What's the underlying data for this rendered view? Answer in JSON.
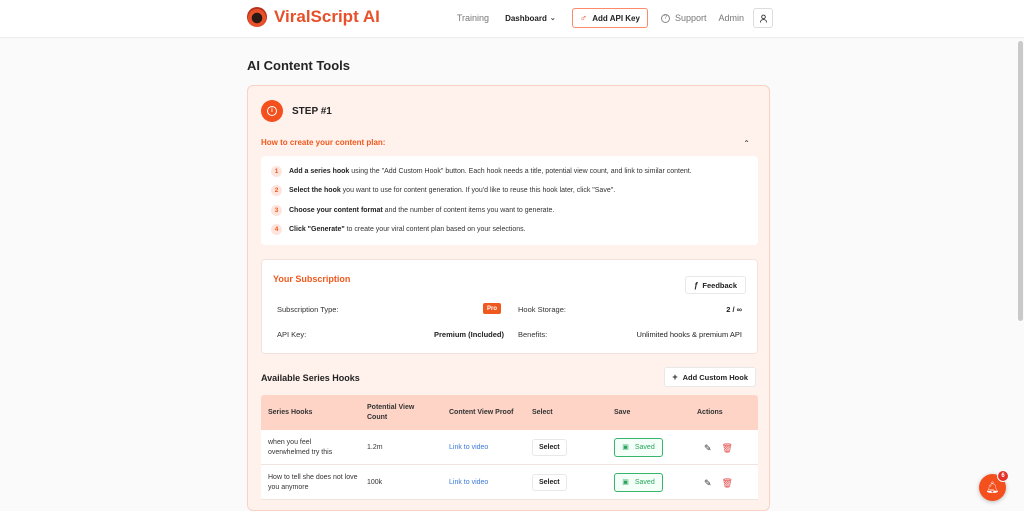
{
  "brand": {
    "name": "ViralScript AI"
  },
  "nav": {
    "training": "Training",
    "dashboard": "Dashboard",
    "add_api_key": "Add API Key",
    "support": "Support",
    "admin": "Admin"
  },
  "page": {
    "title": "AI Content Tools"
  },
  "step": {
    "title": "STEP #1",
    "howto_title": "How to create your content plan:",
    "items": [
      {
        "num": "1",
        "bold": "Add a series hook",
        "text": " using the \"Add Custom Hook\" button. Each hook needs a title, potential view count, and link to similar content."
      },
      {
        "num": "2",
        "bold": "Select the hook",
        "text": " you want to use for content generation. If you'd like to reuse this hook later, click \"Save\"."
      },
      {
        "num": "3",
        "bold": "Choose your content format",
        "text": " and the number of content items you want to generate."
      },
      {
        "num": "4",
        "bold": "Click \"Generate\"",
        "text": " to create your viral content plan based on your selections."
      }
    ]
  },
  "subscription": {
    "title": "Your Subscription",
    "feedback": "Feedback",
    "type_label": "Subscription Type:",
    "type_value": "Pro",
    "storage_label": "Hook Storage:",
    "storage_value": "2 / ∞",
    "api_label": "API Key:",
    "api_value": "Premium (Included)",
    "benefits_label": "Benefits:",
    "benefits_value": "Unlimited hooks & premium API"
  },
  "hooks": {
    "title": "Available Series Hooks",
    "add_button": "Add Custom Hook",
    "columns": [
      "Series Hooks",
      "Potential View Count",
      "Content View Proof",
      "Select",
      "Save",
      "Actions"
    ],
    "rows": [
      {
        "hook": "when you feel overwhelmed try this",
        "views": "1.2m",
        "proof": "Link to video",
        "select": "Select",
        "save": "Saved"
      },
      {
        "hook": "How to tell she does not love you anymore",
        "views": "100k",
        "proof": "Link to video",
        "select": "Select",
        "save": "Saved"
      }
    ]
  },
  "notifications": {
    "count": "6"
  },
  "colors": {
    "accent": "#f3501e",
    "saved": "#28a55b",
    "link": "#3a78d8"
  }
}
